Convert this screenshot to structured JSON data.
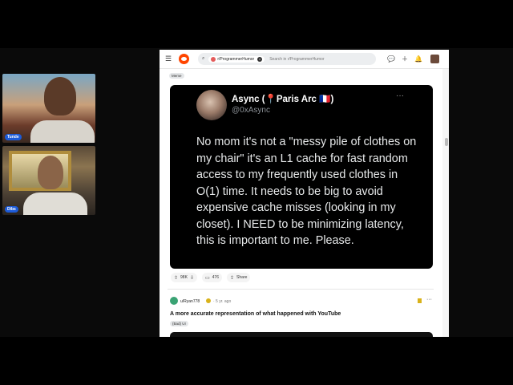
{
  "participants": [
    {
      "name": "Tunde"
    },
    {
      "name": "Dibs"
    }
  ],
  "browser": {
    "search": {
      "subreddit": "r/ProgrammerHumor",
      "placeholder": "Search in r/ProgrammerHumor"
    },
    "colors": {
      "reddit_orange": "#ff4500",
      "tweet_bg": "#000000"
    }
  },
  "post1": {
    "flair": "Meme",
    "tweet": {
      "display_name": "Async (📍Paris Arc 🇫🇷)",
      "handle": "@0xAsync",
      "text": "No mom it's not a \"messy pile of clothes on my chair\" it's an L1 cache for fast random access to my frequently used clothes in O(1) time. It needs to be big to avoid expensive cache misses (looking in my closet). I NEED to be minimizing latency, this is important to me. Please.",
      "more": "···"
    },
    "votes": "98K",
    "comments": "476",
    "share_label": "Share"
  },
  "post2": {
    "user": "u/Ryan778",
    "time": "· 5 yr. ago",
    "more": "···",
    "title": "A more accurate representation of what happened with YouTube",
    "flair": "(Bad) UI"
  }
}
